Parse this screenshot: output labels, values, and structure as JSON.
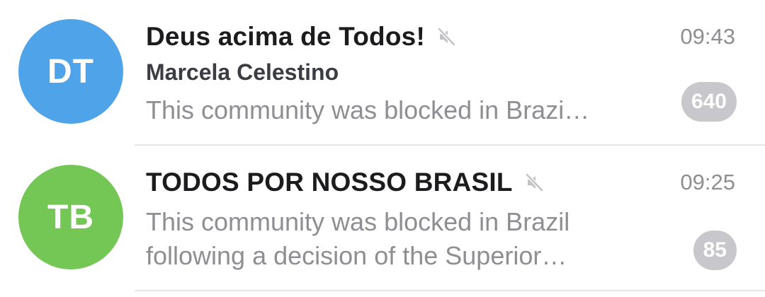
{
  "chats": [
    {
      "initials": "DT",
      "avatar_color": "#4fa3e8",
      "title": "Deus acima de Todos!",
      "muted": true,
      "time": "09:43",
      "sender": "Marcela Celestino",
      "preview_line_1": "This community was blocked in Brazi…",
      "unread": "640"
    },
    {
      "initials": "TB",
      "avatar_color": "#74c655",
      "title": "TODOS POR NOSSO BRASIL",
      "muted": true,
      "time": "09:25",
      "preview_line_1": "This community was blocked in Brazil",
      "preview_line_2": "following a decision of the Superior…",
      "unread": "85"
    }
  ],
  "icons": {
    "mute": "muted-speaker-icon"
  },
  "colors": {
    "badge_muted": "#c7c7cc",
    "secondary_text": "#8e8e93",
    "divider": "#e5e5ea"
  }
}
